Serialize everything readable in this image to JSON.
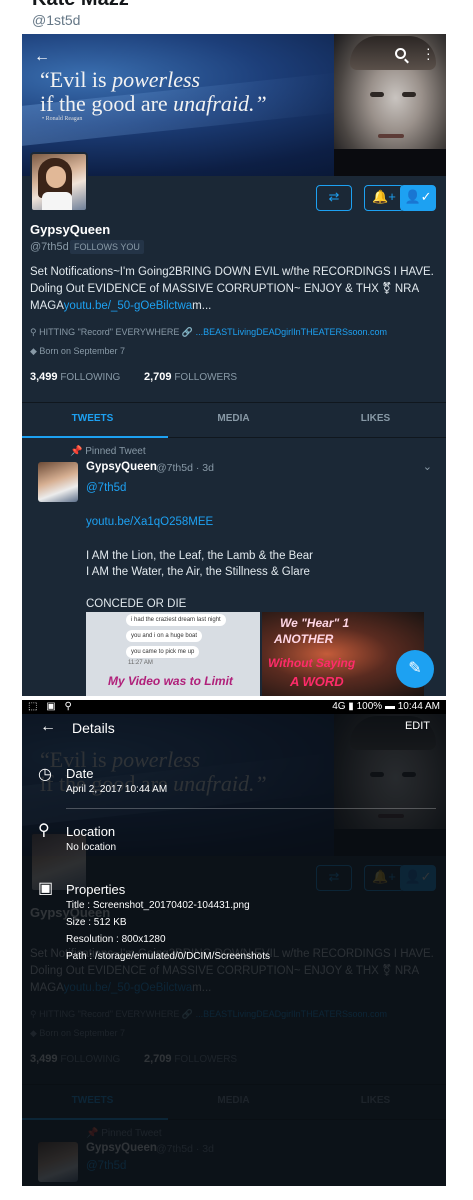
{
  "outer": {
    "name": "Kate Mazz",
    "handle": "@1st5d"
  },
  "profile": {
    "quote_line1_a": "“Evil is ",
    "quote_line1_b": "powerless",
    "quote_line2_a": "if the good are ",
    "quote_line2_b": "unafraid.”",
    "quote_attribution": "• Ronald Reagan",
    "display_name": "GypsyQueen",
    "handle": "@7th5d",
    "follows_you": "FOLLOWS YOU",
    "bio_text": "Set Notifications~I'm Going2BRING DOWN EVIL w/the RECORDINGS I HAVE. Doling Out EVIDENCE of MASSIVE CORRUPTION~ ENJOY & THX ⚧ NRA MAGA",
    "bio_link": "youtu.be/_50-gOeBilctwa",
    "bio_suffix": "m...",
    "location": "HITTING \"Record\" EVERYWHERE",
    "website": "...BEASTLivingDEADgirlInTHEATERSsoon.com",
    "born": "Born on September 7",
    "following_count": "3,499",
    "following_label": "FOLLOWING",
    "followers_count": "2,709",
    "followers_label": "FOLLOWERS"
  },
  "tabs": [
    "TWEETS",
    "MEDIA",
    "LIKES"
  ],
  "tweet": {
    "pinned": "Pinned Tweet",
    "name": "GypsyQueen",
    "handle_time": "@7th5d · 3d",
    "mention": "@7th5d",
    "link": "youtu.be/Xa1qO258MEE",
    "line1": "I AM the Lion, the Leaf, the Lamb & the Bear",
    "line2": "I AM the Water, the Air, the Stillness & Glare",
    "line3": "CONCEDE OR DIE",
    "media_left": {
      "bubble1": "i had the craziest dream last night",
      "bubble2": "you and i on a huge boat",
      "bubble3": "you came to pick me up",
      "time": "11:27 AM",
      "bottom_text": "My Video was to Limit"
    },
    "media_right": {
      "text1": "We \"Hear\" 1",
      "text2": "ANOTHER",
      "text3": "Without Saying",
      "text4": "A WORD"
    }
  },
  "overlay": {
    "status_time": "10:44 AM",
    "status_battery": "100%",
    "status_signal": "4G",
    "title": "Details",
    "edit": "EDIT",
    "date_head": "Date",
    "date_val": "April 2, 2017 10:44 AM",
    "location_head": "Location",
    "location_val": "No location",
    "properties_head": "Properties",
    "prop_title": "Title : Screenshot_20170402-104431.png",
    "prop_size": "Size : 512 KB",
    "prop_resolution": "Resolution : 800x1280",
    "prop_path": "Path : /storage/emulated/0/DCIM/Screenshots"
  },
  "colors": {
    "accent": "#1da1f2",
    "bg": "#1b2836"
  }
}
